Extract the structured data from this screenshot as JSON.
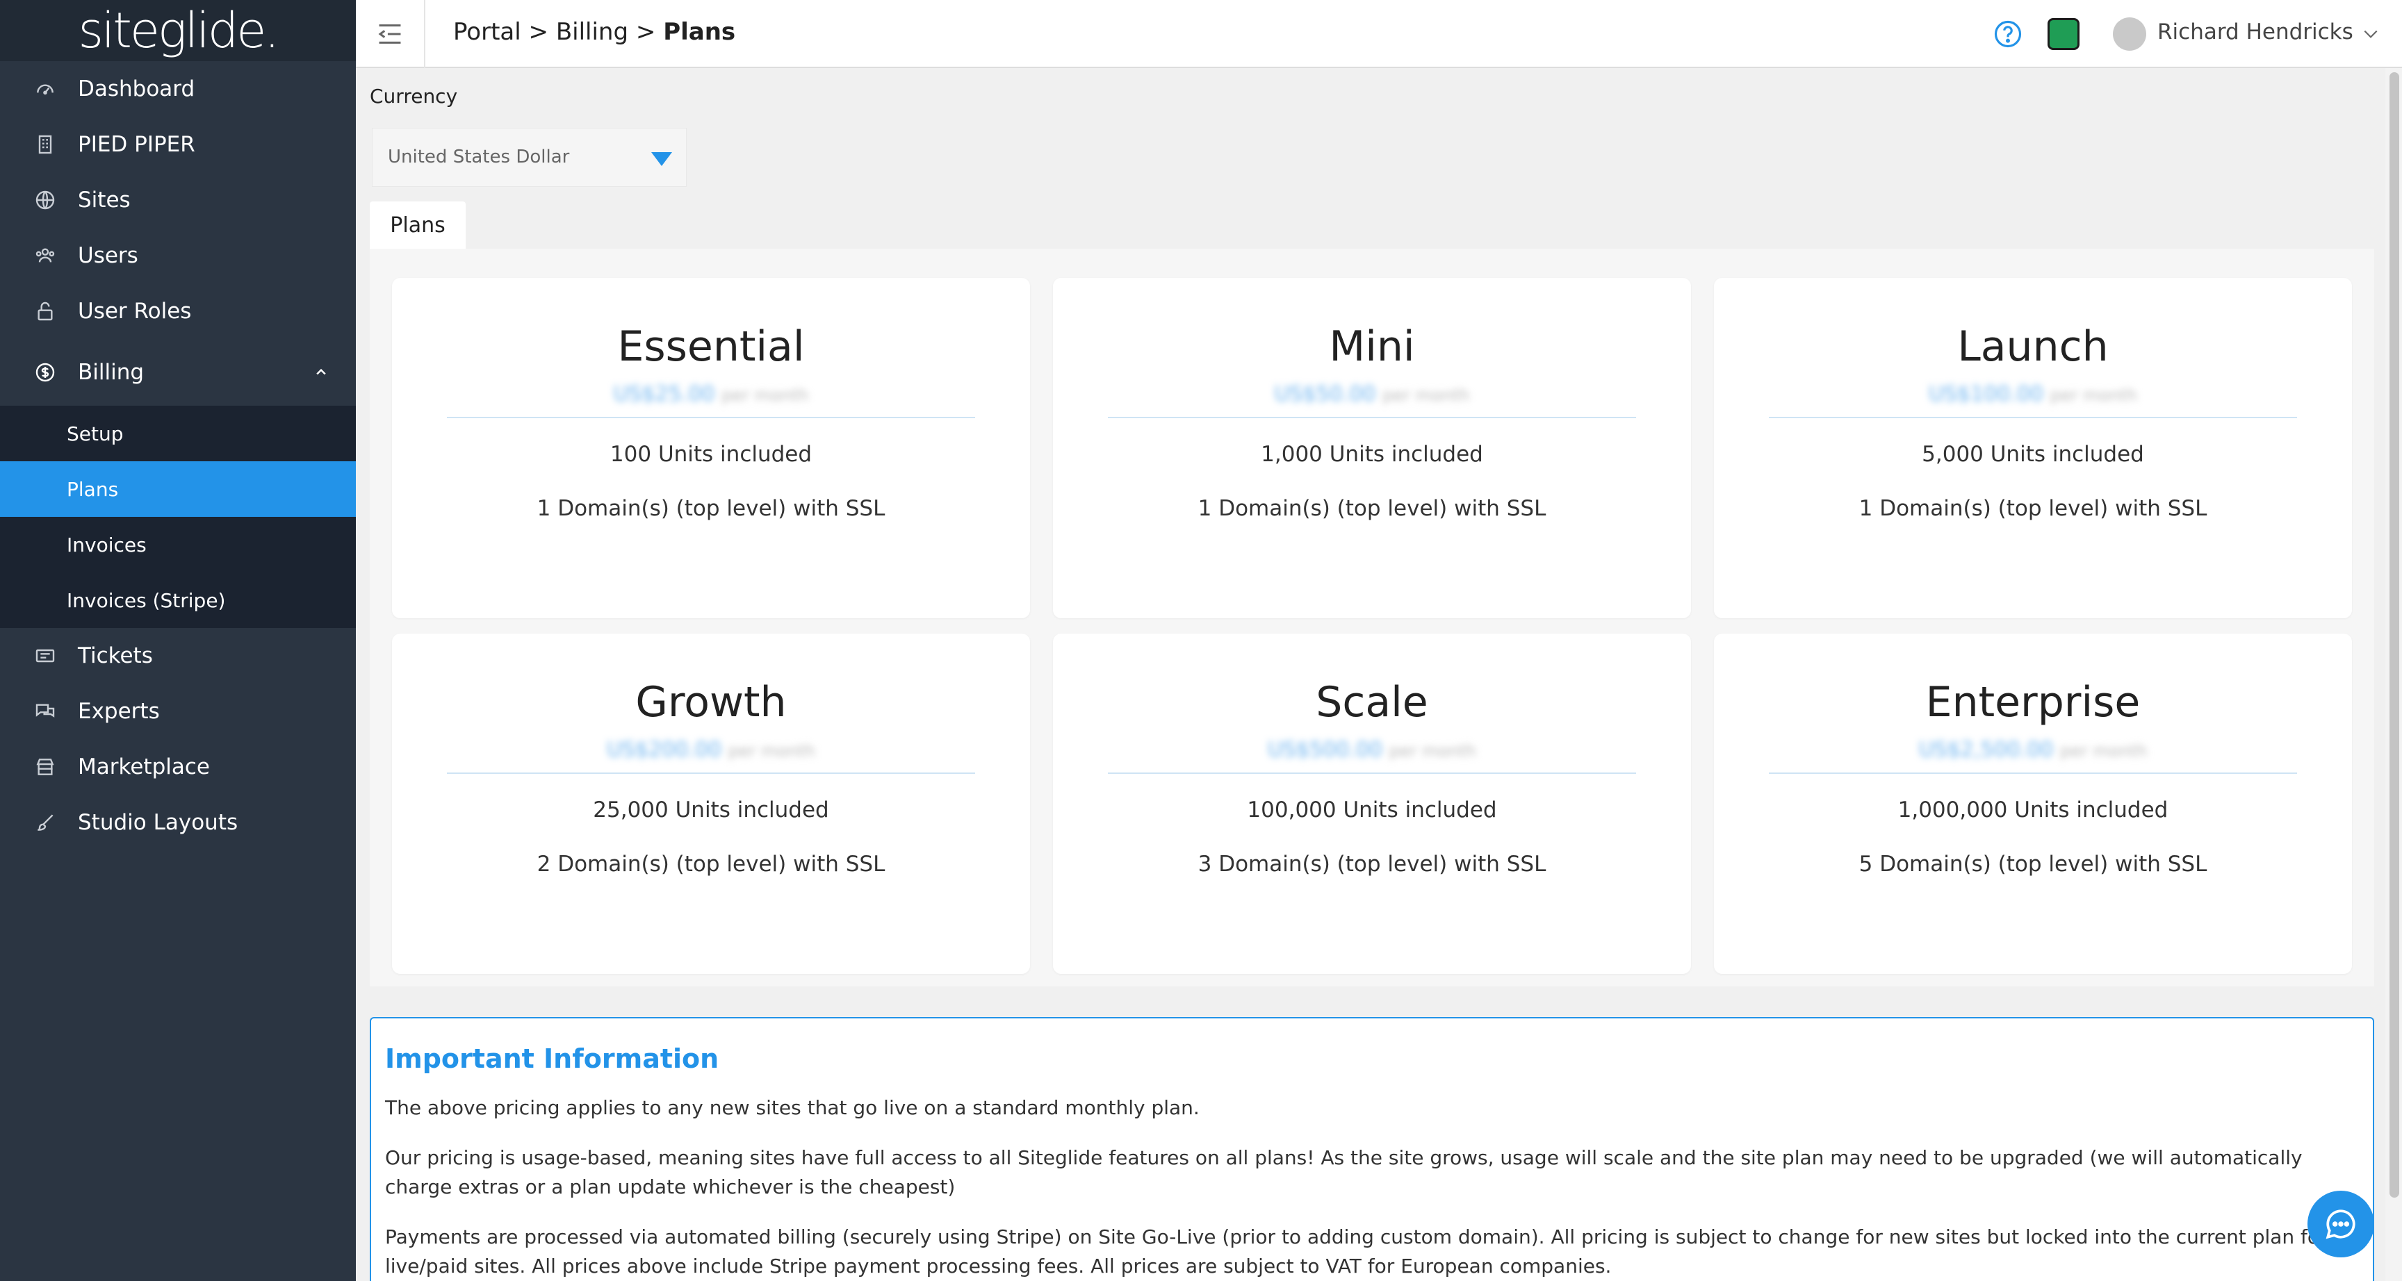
{
  "logo": {
    "text": "siteglide."
  },
  "sidebar": {
    "items": [
      {
        "label": "Dashboard",
        "icon": "dashboard-gauge-icon"
      },
      {
        "label": "PIED PIPER",
        "icon": "building-icon"
      },
      {
        "label": "Sites",
        "icon": "globe-icon"
      },
      {
        "label": "Users",
        "icon": "users-icon"
      },
      {
        "label": "User Roles",
        "icon": "lock-icon"
      }
    ],
    "billing": {
      "label": "Billing",
      "icon": "dollar-circle-icon"
    },
    "billing_sub": [
      "Setup",
      "Plans",
      "Invoices",
      "Invoices (Stripe)"
    ],
    "items_after": [
      {
        "label": "Tickets",
        "icon": "ticket-icon"
      },
      {
        "label": "Experts",
        "icon": "chat-bubbles-icon"
      },
      {
        "label": "Marketplace",
        "icon": "storefront-icon"
      },
      {
        "label": "Studio Layouts",
        "icon": "brush-icon"
      }
    ]
  },
  "header": {
    "breadcrumb_1": "Portal",
    "breadcrumb_2": "Billing",
    "breadcrumb_current": "Plans",
    "separator": ">",
    "user_name": "Richard Hendricks"
  },
  "currency": {
    "label": "Currency",
    "selected": "United States Dollar"
  },
  "tabs": {
    "plans": "Plans"
  },
  "plans": [
    {
      "name": "Essential",
      "price": "US$25.00",
      "period": "per month",
      "units": "100 Units included",
      "domains": "1 Domain(s) (top level) with SSL"
    },
    {
      "name": "Mini",
      "price": "US$50.00",
      "period": "per month",
      "units": "1,000 Units included",
      "domains": "1 Domain(s) (top level) with SSL"
    },
    {
      "name": "Launch",
      "price": "US$100.00",
      "period": "per month",
      "units": "5,000 Units included",
      "domains": "1 Domain(s) (top level) with SSL"
    },
    {
      "name": "Growth",
      "price": "US$200.00",
      "period": "per month",
      "units": "25,000 Units included",
      "domains": "2 Domain(s) (top level) with SSL"
    },
    {
      "name": "Scale",
      "price": "US$500.00",
      "period": "per month",
      "units": "100,000 Units included",
      "domains": "3 Domain(s) (top level) with SSL"
    },
    {
      "name": "Enterprise",
      "price": "US$2,500.00",
      "period": "per month",
      "units": "1,000,000 Units included",
      "domains": "5 Domain(s) (top level) with SSL"
    }
  ],
  "info": {
    "title": "Important Information",
    "p1": "The above pricing applies to any new sites that go live on a standard monthly plan.",
    "p2": "Our pricing is usage-based, meaning sites have full access to all Siteglide features on all plans! As the site grows, usage will scale and the site plan may need to be upgraded (we will automatically charge extras or a plan update whichever is the cheapest)",
    "p3": "Payments are processed via automated billing (securely using Stripe) on Site Go-Live (prior to adding custom domain). All pricing is subject to change for new sites but locked into the current plan for live/paid sites. All prices above include Stripe payment processing fees. All prices are subject to VAT for European companies."
  },
  "colors": {
    "sidebar": "#2b3542",
    "accent": "#2393e8",
    "subnav": "#1b2330"
  }
}
